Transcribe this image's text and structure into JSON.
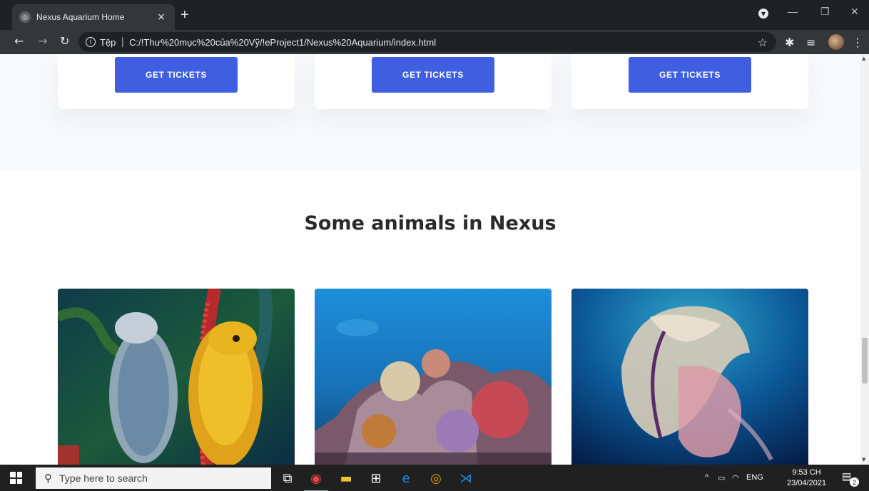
{
  "browser": {
    "tab_title": "Nexus Aquarium Home",
    "tab_close": "×",
    "new_tab": "+",
    "site_label": "Tệp",
    "url": "C:/!Thư%20mục%20của%20Vỹ/!eProject1/Nexus%20Aquarium/index.html",
    "icons": [
      "back-arrow-icon",
      "forward-arrow-icon",
      "reload-icon",
      "info-icon",
      "star-icon",
      "extensions-icon",
      "reading-list-icon",
      "profile-avatar-icon",
      "kebab-menu-icon"
    ]
  },
  "page": {
    "ticket_buttons": [
      "GET TICKETS",
      "GET TICKETS",
      "GET TICKETS"
    ],
    "section_title": "Some animals in Nexus",
    "animals": [
      "seahorse",
      "coral-reef",
      "jellyfish"
    ]
  },
  "taskbar": {
    "search_placeholder": "Type here to search",
    "language": "ENG",
    "time": "9:53 CH",
    "date": "23/04/2021",
    "notification_count": "2"
  },
  "colors": {
    "accent": "#3f5fe0",
    "title_text": "#2a2a2a",
    "section_bg": "#f8f9fc"
  }
}
